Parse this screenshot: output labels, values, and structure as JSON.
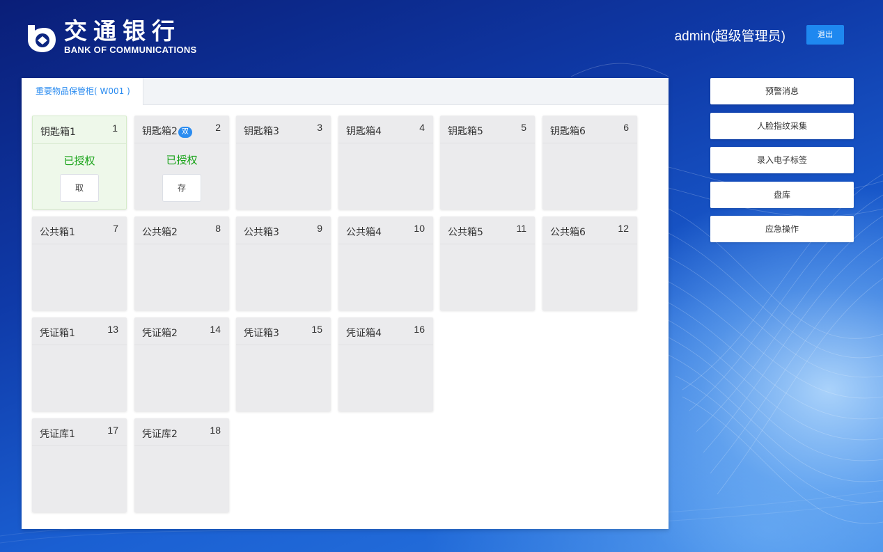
{
  "header": {
    "logo_cn": "交通银行",
    "logo_en": "BANK OF COMMUNICATIONS",
    "user": "admin(超级管理员)",
    "logout_label": "退出"
  },
  "panel": {
    "tab_label": "重要物品保管柜( W001 )"
  },
  "boxes": [
    {
      "name": "钥匙箱1",
      "num": "1",
      "status": "已授权",
      "action": "取"
    },
    {
      "name": "钥匙箱2",
      "num": "2",
      "badge": "双",
      "status": "已授权",
      "action": "存"
    },
    {
      "name": "钥匙箱3",
      "num": "3"
    },
    {
      "name": "钥匙箱4",
      "num": "4"
    },
    {
      "name": "钥匙箱5",
      "num": "5"
    },
    {
      "name": "钥匙箱6",
      "num": "6"
    },
    {
      "name": "公共箱1",
      "num": "7"
    },
    {
      "name": "公共箱2",
      "num": "8"
    },
    {
      "name": "公共箱3",
      "num": "9"
    },
    {
      "name": "公共箱4",
      "num": "10"
    },
    {
      "name": "公共箱5",
      "num": "11"
    },
    {
      "name": "公共箱6",
      "num": "12"
    },
    {
      "name": "凭证箱1",
      "num": "13"
    },
    {
      "name": "凭证箱2",
      "num": "14"
    },
    {
      "name": "凭证箱3",
      "num": "15"
    },
    {
      "name": "凭证箱4",
      "num": "16"
    },
    {
      "name": "凭证库1",
      "num": "17"
    },
    {
      "name": "凭证库2",
      "num": "18"
    }
  ],
  "side_buttons": [
    "预警消息",
    "人脸指纹采集",
    "录入电子标签",
    "盘库",
    "应急操作"
  ],
  "colors": {
    "accent": "#2b8cf0",
    "authorized_text": "#19a319",
    "active_box_bg": "#eef8ea",
    "box_bg": "#ebebed"
  }
}
